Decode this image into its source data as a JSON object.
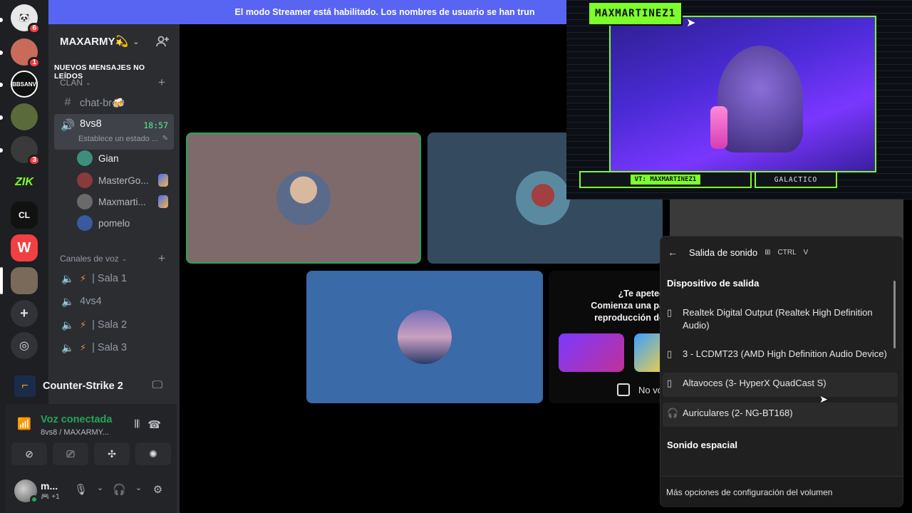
{
  "rail": {
    "servers": [
      {
        "name": "server-1",
        "badge": "6",
        "color": "#e8e8e8"
      },
      {
        "name": "server-2",
        "badge": "1",
        "color": "#c96b5a"
      },
      {
        "name": "bbsanv",
        "badge": "",
        "label": "BBSANV",
        "color": "#111111"
      },
      {
        "name": "server-4",
        "badge": "",
        "color": "#5a6a3a"
      },
      {
        "name": "server-5",
        "badge": "3",
        "color": "#3a3a3a"
      },
      {
        "name": "zik",
        "badge": "",
        "label": "ZIK",
        "color": "#1e1f22"
      },
      {
        "name": "cl",
        "badge": "",
        "label": "CL",
        "color": "#111111"
      },
      {
        "name": "w",
        "badge": "",
        "label": "W",
        "color": "#f23f43"
      },
      {
        "name": "maxarmy",
        "badge": "",
        "color": "#7a6a5a"
      }
    ],
    "add_icon": "plus-icon",
    "discover_icon": "compass-icon"
  },
  "server": {
    "name": "MAXARMY💫",
    "new_messages": "NUEVOS MENSAJES NO LEÍDOS",
    "category_clan": "CLAN",
    "text_channel": "chat-br🍻",
    "active_channel": {
      "name": "8vs8",
      "time": "18:57",
      "status": "Establece un estado ..."
    },
    "members": [
      {
        "name": "Gian",
        "color": "#3e8e7e"
      },
      {
        "name": "MasterGo...",
        "color": "#8a3a3a"
      },
      {
        "name": "Maxmarti...",
        "color": "#6a6a6a"
      },
      {
        "name": "pomelo",
        "color": "#3a5aa0"
      }
    ],
    "voice_category": "Canales de voz",
    "voice_channels": [
      {
        "name": "| Sala 1",
        "zap": true
      },
      {
        "name": "4vs4",
        "zap": false
      },
      {
        "name": "| Sala 2",
        "zap": true
      },
      {
        "name": "| Sala 3",
        "zap": true
      }
    ]
  },
  "activity": {
    "game": "Counter-Strike 2"
  },
  "voice": {
    "title": "Voz conectada",
    "subtitle": "8vs8 / MAXARMY..."
  },
  "user": {
    "name": "m...",
    "status": "+1"
  },
  "main": {
    "streamer_notice": "El modo Streamer está habilitado. Los nombres de usuario se han trun",
    "promo_text": "¿Te apetec\nComienza una pa\nreproducción de",
    "promo_checkbox": "No vo"
  },
  "cam": {
    "tag": "MAXMARTINEZ1",
    "vt": "VT: MAXMARTINEZ1",
    "right": "GALACTICO"
  },
  "flyout": {
    "title": "Salida de sonido",
    "kbd1": "CTRL",
    "kbd2": "V",
    "section_output": "Dispositivo de salida",
    "devices": [
      {
        "name": "Realtek Digital Output (Realtek High Definition Audio)",
        "icon": "speaker-icon"
      },
      {
        "name": "3 - LCDMT23 (AMD High Definition Audio Device)",
        "icon": "speaker-icon"
      },
      {
        "name": "Altavoces (3- HyperX QuadCast S)",
        "icon": "speaker-icon"
      },
      {
        "name": "Auriculares (2- NG-BT168)",
        "icon": "headphones-icon"
      }
    ],
    "section_spatial": "Sonido espacial",
    "footer": "Más opciones de configuración del volumen"
  }
}
